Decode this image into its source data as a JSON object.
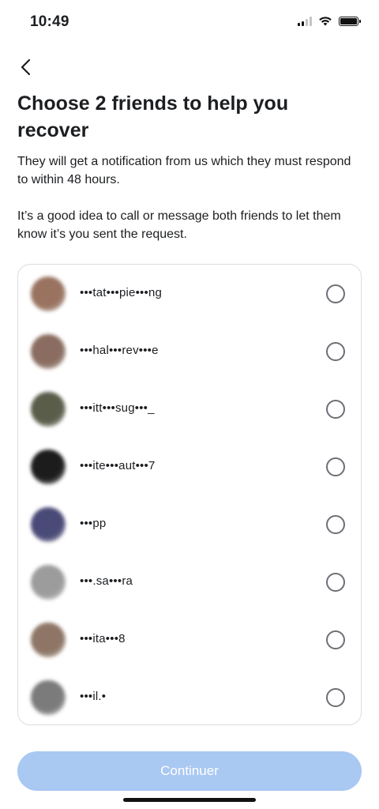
{
  "status_bar": {
    "time": "10:49",
    "signal_icon": "cellular-signal-icon",
    "wifi_icon": "wifi-icon",
    "battery_icon": "battery-icon"
  },
  "header": {
    "back_icon": "chevron-left-icon",
    "title": "Choose 2 friends to help you recover",
    "description_1": "They will get a notification from us which they must respond to within 48 hours.",
    "description_2": "It’s a good idea to call or message both friends to let them know it’s you sent the request."
  },
  "friends": [
    {
      "name": "•••tat•••pie•••ng",
      "avatar_color": "#9a7360"
    },
    {
      "name": "•••hal•••rev•••e",
      "avatar_color": "#8a6d60"
    },
    {
      "name": "•••itt•••sug•••_",
      "avatar_color": "#5a5d4a"
    },
    {
      "name": "•••ite•••aut•••7",
      "avatar_color": "#1c1c1c"
    },
    {
      "name": "•••pp",
      "avatar_color": "#4a4a78"
    },
    {
      "name": "•••.sa•••ra",
      "avatar_color": "#9c9c9c"
    },
    {
      "name": "•••ita•••8",
      "avatar_color": "#8e7565"
    },
    {
      "name": "•••il.•",
      "avatar_color": "#7b7b7b"
    }
  ],
  "actions": {
    "continue_label": "Continuer",
    "continue_color": "#a9c8f2"
  }
}
